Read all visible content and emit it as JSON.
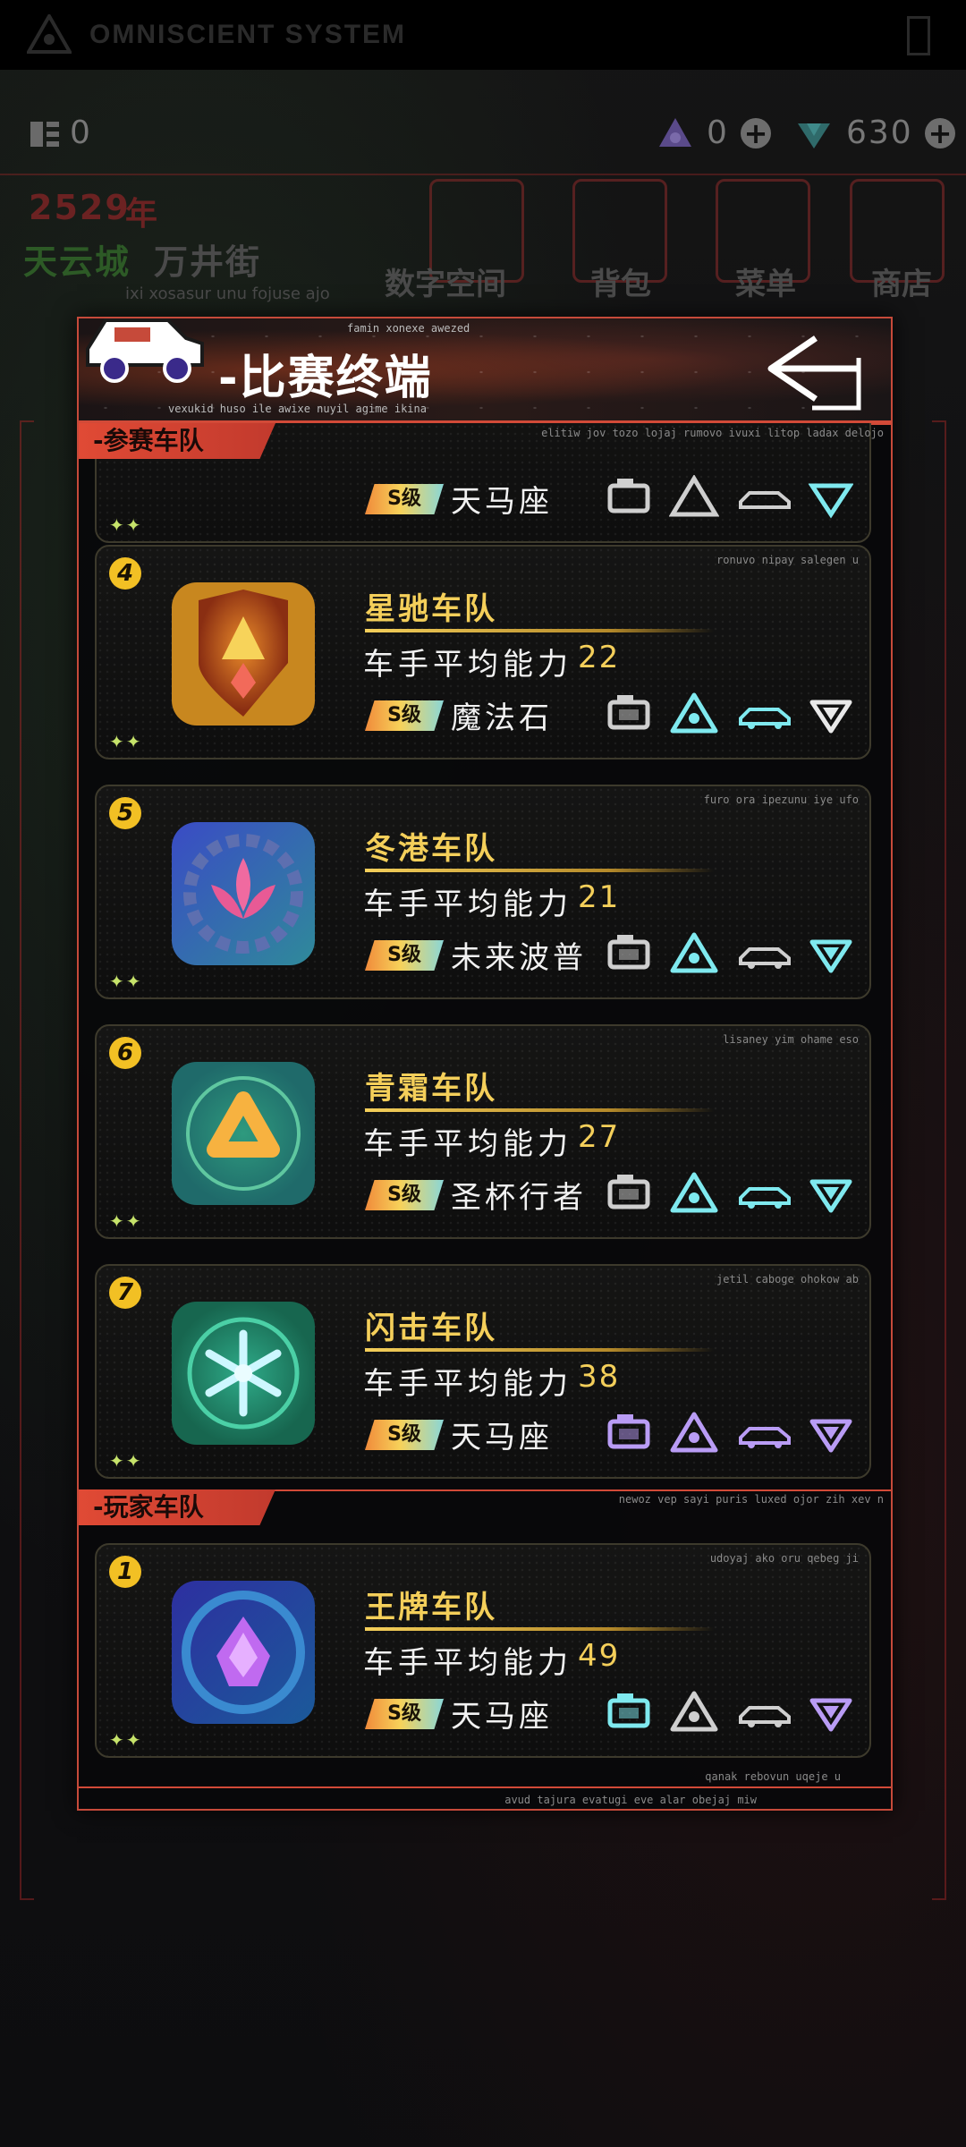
{
  "status_bar": {
    "system_name": "OMNISCIENT SYSTEM"
  },
  "resources": {
    "chips": "0",
    "crystal": "0",
    "gems": "630"
  },
  "world": {
    "year": "2529",
    "year_unit": "年",
    "city": "天云城",
    "street": "万井街"
  },
  "bg_nav": [
    "数字空间",
    "背包",
    "菜单",
    "商店"
  ],
  "bg_tip": "ixi xosasur unu fojuse ajo",
  "header": {
    "title": "-比赛终端",
    "deco_top": "famin xonexe awezed",
    "deco_bottom": "vexukid huso ile awixe nuyil agime ikina"
  },
  "sections": {
    "participating": {
      "label": "-参赛车队",
      "tip": "elitiw jov tozo lojaj rumovo ivuxi litop ladax delojo"
    },
    "player": {
      "label": "-玩家车队",
      "tip": "newoz vep sayi puris luxed ojor zih xev n"
    }
  },
  "partial_card": {
    "grade": "S级",
    "driver": "天马座"
  },
  "teams": [
    {
      "rank": "4",
      "name": "星驰车队",
      "ability_label": "车手平均能力",
      "ability": "22",
      "grade": "S级",
      "driver": "魔法石",
      "tip": "ronuvo nipay salegen u",
      "parts": {
        "engine": "#cfcfcf",
        "wheel": "#7fe9ef",
        "car": "#7fe9ef",
        "gem": "#e9e9e9"
      }
    },
    {
      "rank": "5",
      "name": "冬港车队",
      "ability_label": "车手平均能力",
      "ability": "21",
      "grade": "S级",
      "driver": "未来波普",
      "tip": "furo ora ipezunu iye ufo",
      "parts": {
        "engine": "#cfcfcf",
        "wheel": "#7fe9ef",
        "car": "#cfcfcf",
        "gem": "#7fe9ef"
      }
    },
    {
      "rank": "6",
      "name": "青霜车队",
      "ability_label": "车手平均能力",
      "ability": "27",
      "grade": "S级",
      "driver": "圣杯行者",
      "tip": "lisaney yim ohame eso",
      "parts": {
        "engine": "#cfcfcf",
        "wheel": "#7fe9ef",
        "car": "#7fe9ef",
        "gem": "#7fe9ef"
      }
    },
    {
      "rank": "7",
      "name": "闪击车队",
      "ability_label": "车手平均能力",
      "ability": "38",
      "grade": "S级",
      "driver": "天马座",
      "tip": "jetil caboge ohokow ab",
      "parts": {
        "engine": "#b99cf5",
        "wheel": "#b99cf5",
        "car": "#b99cf5",
        "gem": "#b99cf5"
      }
    }
  ],
  "player_team": {
    "rank": "1",
    "name": "王牌车队",
    "ability_label": "车手平均能力",
    "ability": "49",
    "grade": "S级",
    "driver": "天马座",
    "tip": "udoyaj ako oru qebeg ji",
    "parts": {
      "engine": "#7fe9ef",
      "wheel": "#cfcfcf",
      "car": "#cfcfcf",
      "gem": "#b99cf5"
    }
  },
  "footer_tips": {
    "line1": "qanak rebovun uqeje u",
    "line2": "avud tajura evatugi eve alar obejaj miw"
  },
  "sparkle": "✦✦"
}
